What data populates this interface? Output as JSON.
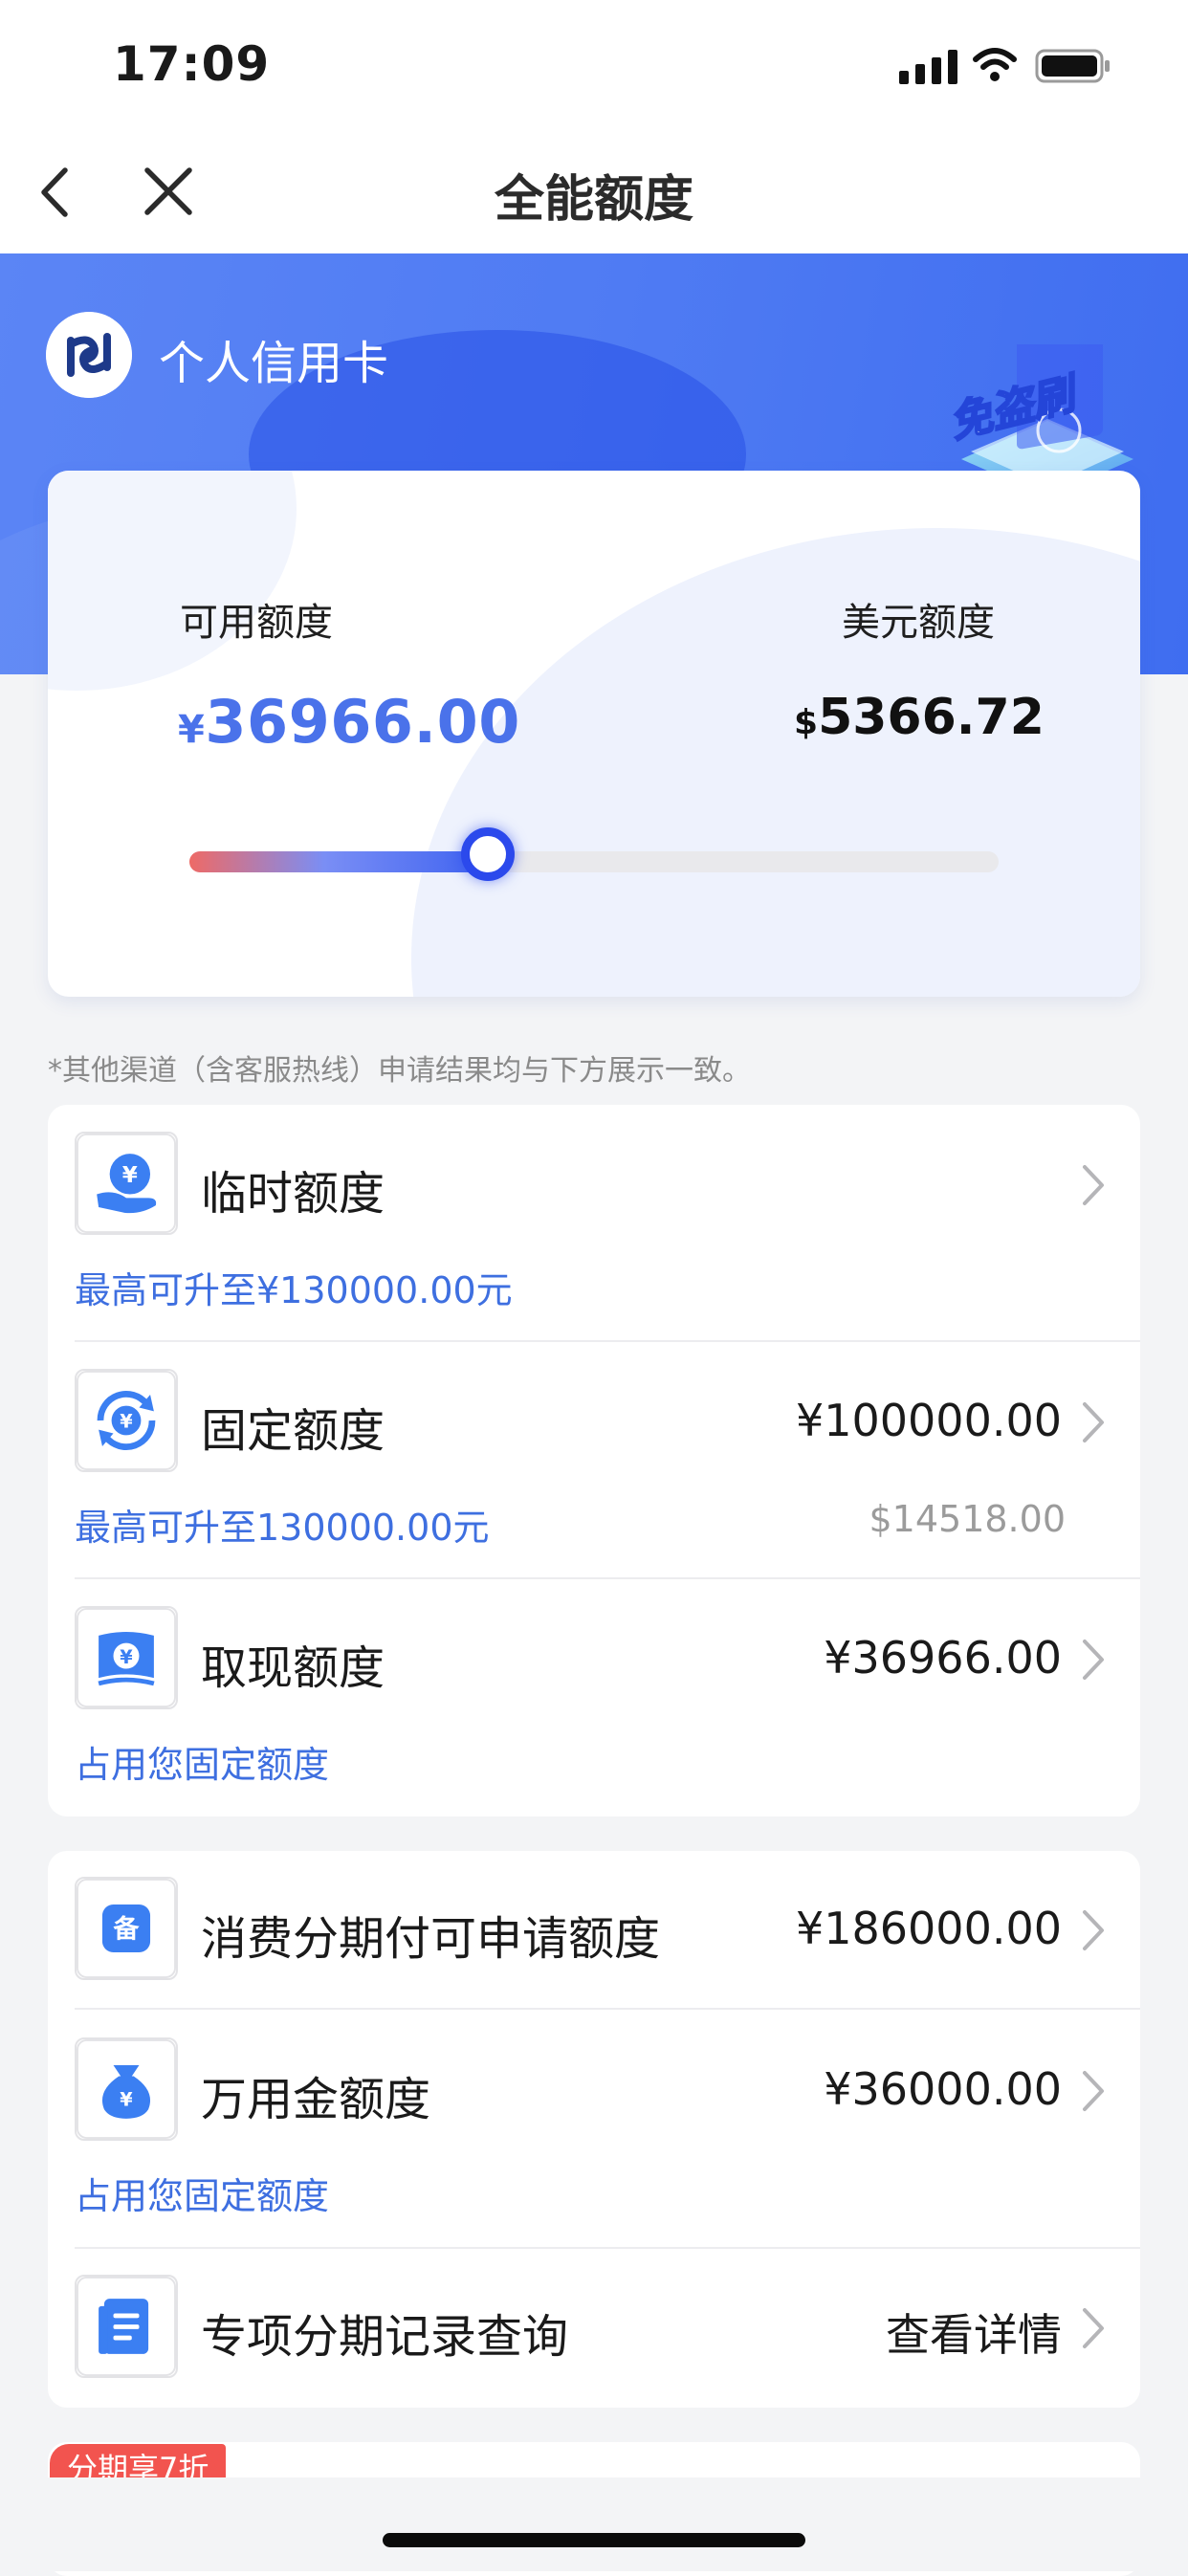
{
  "status_bar": {
    "time": "17:09"
  },
  "nav": {
    "title": "全能额度"
  },
  "header": {
    "card_name": "个人信用卡",
    "badge_text": "免盗刷"
  },
  "limit_card": {
    "available_label": "可用额度",
    "available_currency": "¥",
    "available_amount": "36966.00",
    "usd_label": "美元额度",
    "usd_currency": "$",
    "usd_amount": "5366.72",
    "usage_fraction": 0.37
  },
  "disclaimer": "*其他渠道（含客服热线）申请结果均与下方展示一致。",
  "limits_group": [
    {
      "title": "临时额度",
      "value": "",
      "sub": "最高可升至¥130000.00元",
      "sub_right": ""
    },
    {
      "title": "固定额度",
      "value": "¥100000.00",
      "sub": "最高可升至130000.00元",
      "sub_right": "$14518.00"
    },
    {
      "title": "取现额度",
      "value": "¥36966.00",
      "sub": "占用您固定额度",
      "sub_right": ""
    }
  ],
  "installment_group": [
    {
      "title": "消费分期付可申请额度",
      "value": "¥186000.00",
      "sub": ""
    },
    {
      "title": "万用金额度",
      "value": "¥36000.00",
      "sub": "占用您固定额度"
    },
    {
      "title": "专项分期记录查询",
      "value": "查看详情",
      "sub": ""
    }
  ],
  "promo": {
    "tag": "分期享7折"
  },
  "colors": {
    "accent": "#3e6fe0",
    "banner": "#4f7bf3",
    "promo": "#f2544f"
  }
}
